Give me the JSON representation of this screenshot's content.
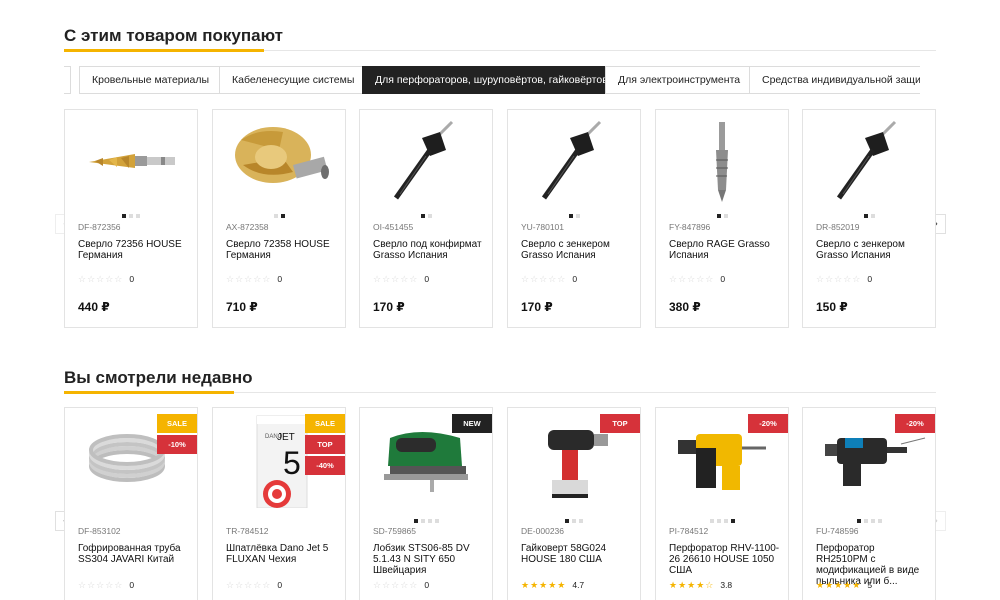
{
  "section1": {
    "title": "С этим товаром покупают"
  },
  "tabs": [
    {
      "label": "Кровельные материалы"
    },
    {
      "label": "Кабеленесущие системы"
    },
    {
      "label": "Для перфораторов, шуруповёртов, гайковёртов"
    },
    {
      "label": "Для электроинструмента"
    },
    {
      "label": "Средства индивидуальной защиты"
    }
  ],
  "row1": [
    {
      "sku": "DF-872356",
      "name": "Сверло 72356 HOUSE Германия",
      "rating": "☆☆☆☆☆",
      "count": "0",
      "price": "440 ₽"
    },
    {
      "sku": "AX-872358",
      "name": "Сверло 72358 HOUSE Германия",
      "rating": "☆☆☆☆☆",
      "count": "0",
      "price": "710 ₽"
    },
    {
      "sku": "OI-451455",
      "name": "Сверло под конфирмат Grasso Испания",
      "rating": "☆☆☆☆☆",
      "count": "0",
      "price": "170 ₽"
    },
    {
      "sku": "YU-780101",
      "name": "Сверло с зенкером Grasso Испания",
      "rating": "☆☆☆☆☆",
      "count": "0",
      "price": "170 ₽"
    },
    {
      "sku": "FY-847896",
      "name": "Сверло RAGE Grasso Испания",
      "rating": "☆☆☆☆☆",
      "count": "0",
      "price": "380 ₽"
    },
    {
      "sku": "DR-852019",
      "name": "Сверло с зенкером Grasso Испания",
      "rating": "☆☆☆☆☆",
      "count": "0",
      "price": "150 ₽"
    }
  ],
  "section2": {
    "title": "Вы смотрели недавно"
  },
  "row2": [
    {
      "sku": "DF-853102",
      "name": "Гофрированная труба SS304 JAVARI Китай",
      "rating": "☆☆☆☆☆",
      "count": "0",
      "badges": [
        "SALE",
        "-10%"
      ]
    },
    {
      "sku": "TR-784512",
      "name": "Шпатлёвка Dano Jet 5 FLUXAN Чехия",
      "rating": "☆☆☆☆☆",
      "count": "0",
      "badges": [
        "SALE",
        "TOP",
        "-40%"
      ],
      "packaging_text": {
        "brand": "DANO",
        "product": "JET",
        "number": "5"
      }
    },
    {
      "sku": "SD-759865",
      "name": "Лобзик STS06-85 DV 5.1.43 N SITY 650 Швейцария",
      "rating": "☆☆☆☆☆",
      "count": "0",
      "badges": [
        "NEW"
      ]
    },
    {
      "sku": "DE-000236",
      "name": "Гайковерт 58G024 HOUSE 180 США",
      "rating": "★★★★★",
      "count": "4.7",
      "badges": [
        "TOP"
      ]
    },
    {
      "sku": "PI-784512",
      "name": "Перфоратор RHV-1100-26 26610 HOUSE 1050 США",
      "rating": "★★★★☆",
      "count": "3.8",
      "badges": [
        "-20%"
      ]
    },
    {
      "sku": "FU-748596",
      "name": "Перфоратор RH2510PM с модификацией в виде пыльника или б...",
      "rating": "★★★★★",
      "count": "5",
      "badges": [
        "-20%"
      ]
    }
  ],
  "colors": {
    "accent": "#f5b400",
    "badge_red": "#d6323a",
    "badge_black": "#222222",
    "star_gold": "#f5b400",
    "star_empty": "#d8d8d8"
  },
  "icons": {
    "prev": "chevron-left-icon",
    "next": "chevron-right-icon"
  },
  "nav": {
    "prev": "‹",
    "next": "›"
  }
}
